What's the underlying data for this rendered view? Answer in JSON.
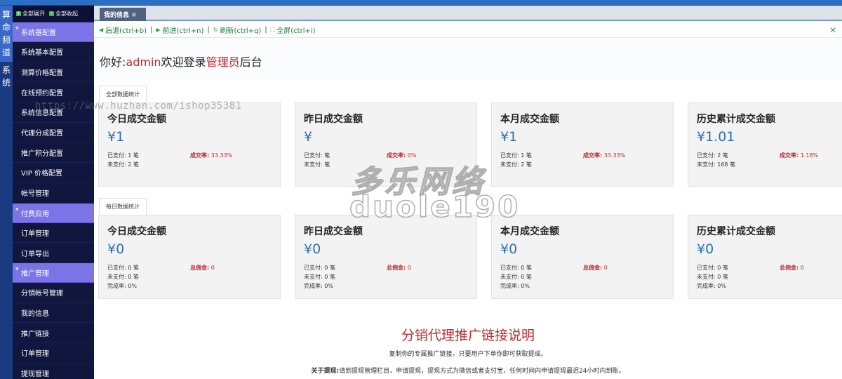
{
  "left_nav": {
    "items": [
      {
        "label": "算\n命\n频\n道",
        "active": true
      },
      {
        "label": "系\n统",
        "active": false
      }
    ]
  },
  "sidebar": {
    "expand_all": "全部展开",
    "collapse_all": "全部收起",
    "groups": [
      {
        "label": "系统基配置",
        "items": [
          "系统基本配置",
          "测算价格配置",
          "在线预约配置",
          "系统信息配置",
          "代理分成配置",
          "推广积分配置",
          "VIP 价格配置",
          "帐号管理"
        ]
      },
      {
        "label": "付费应用",
        "items": [
          "订单管理",
          "订单导出"
        ]
      },
      {
        "label": "推广管理",
        "items": [
          "分销帐号管理",
          "我的信息",
          "推广链接",
          "订单管理",
          "提现管理"
        ]
      }
    ]
  },
  "tabs": [
    {
      "label": "我的信息"
    }
  ],
  "toolbar": {
    "back": "后退(ctrl+b)",
    "forward": "前进(ctrl+n)",
    "refresh": "刷新(ctrl+q)",
    "fullscreen": "全屏(ctrl+i)"
  },
  "welcome": {
    "greeting": "你好:",
    "username": "admin",
    "middle": "欢迎登录",
    "role": "管理员",
    "suffix": "后台"
  },
  "sections": [
    {
      "tab": "全部数据统计",
      "cards": [
        {
          "title": "今日成交金额",
          "amount": "¥1",
          "paid": "已支付: 1 笔",
          "unpaid": "未支付: 2 笔",
          "rate_label": "成交率:",
          "rate": " 33.33%"
        },
        {
          "title": "昨日成交金额",
          "amount": "¥",
          "paid": "已支付: 笔",
          "unpaid": "未支付: 笔",
          "rate_label": "成交率:",
          "rate": " 0%"
        },
        {
          "title": "本月成交金额",
          "amount": "¥1",
          "paid": "已支付: 1 笔",
          "unpaid": "未支付: 2 笔",
          "rate_label": "成交率:",
          "rate": " 33.33%"
        },
        {
          "title": "历史累计成交金额",
          "amount": "¥1.01",
          "paid": "已支付: 2 笔",
          "unpaid": "未支付: 168 笔",
          "rate_label": "成交率:",
          "rate": " 1.18%"
        }
      ]
    },
    {
      "tab": "每日数据统计",
      "cards": [
        {
          "title": "今日成交金额",
          "amount": "¥0",
          "paid": "已支付: 0 笔",
          "unpaid": "未支付: 0 笔",
          "complete": "完成率: 0%",
          "rate_label": "总佣金:",
          "rate": " 0"
        },
        {
          "title": "昨日成交金额",
          "amount": "¥0",
          "paid": "已支付: 0 笔",
          "unpaid": "未支付: 0 笔",
          "complete": "完成率: 0%",
          "rate_label": "总佣金:",
          "rate": " 0"
        },
        {
          "title": "本月成交金额",
          "amount": "¥0",
          "paid": "已支付: 0 笔",
          "unpaid": "未支付: 0 笔",
          "complete": "完成率: 0%",
          "rate_label": "总佣金:",
          "rate": " 0"
        },
        {
          "title": "历史累计成交金额",
          "amount": "¥0",
          "paid": "已支付: 0 笔",
          "unpaid": "未支付: 0 笔",
          "complete": "完成率: 0%",
          "rate_label": "总佣金:",
          "rate": " 0"
        }
      ]
    }
  ],
  "promo": {
    "title": "分销代理推广链接说明",
    "desc": "复制你的专属推广链接，只要用户下单你即可获取提成。",
    "note_label": "关于提现:",
    "note_text": "请到提现管理栏目，申请提现，提现方式为微信或者支付宝，任何时间内申请提现最迟24小时内到账。"
  },
  "watermark": {
    "url": "https://www.huzhan.com/ishop35381",
    "cn": "多乐网络",
    "en": "duole190"
  }
}
